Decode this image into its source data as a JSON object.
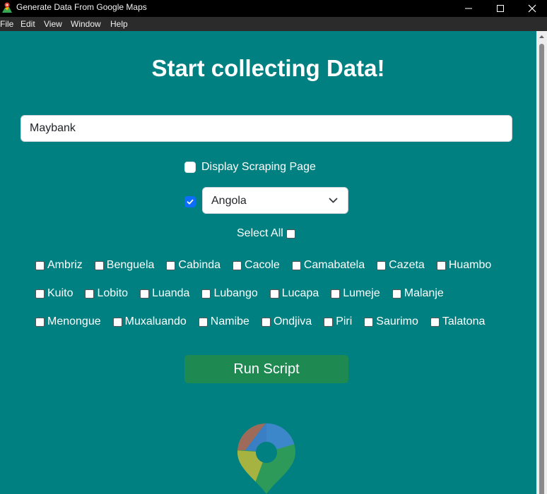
{
  "window": {
    "title": "Generate Data From Google Maps",
    "controls": [
      "minimize",
      "maximize",
      "close"
    ]
  },
  "menu": [
    "File",
    "Edit",
    "View",
    "Window",
    "Help"
  ],
  "main": {
    "heading": "Start collecting Data!",
    "search": {
      "value": "Maybank"
    },
    "display_scraping": {
      "label": "Display Scraping Page",
      "checked": false
    },
    "country": {
      "checked": true,
      "selected": "Angola"
    },
    "select_all": {
      "label": "Select All",
      "checked": false
    },
    "cities": [
      [
        "Ambriz",
        "Benguela",
        "Cabinda",
        "Cacole",
        "Camabatela",
        "Cazeta",
        "Huambo"
      ],
      [
        "Kuito",
        "Lobito",
        "Luanda",
        "Lubango",
        "Lucapa",
        "Lumeje",
        "Malanje"
      ],
      [
        "Menongue",
        "Muxaluando",
        "Namibe",
        "Ondjiva",
        "Piri",
        "Saurimo",
        "Talatona"
      ]
    ],
    "run_button": "Run Script"
  },
  "colors": {
    "background": "#008080",
    "accent": "#0d6efd",
    "run_button": "#1e8a52"
  }
}
